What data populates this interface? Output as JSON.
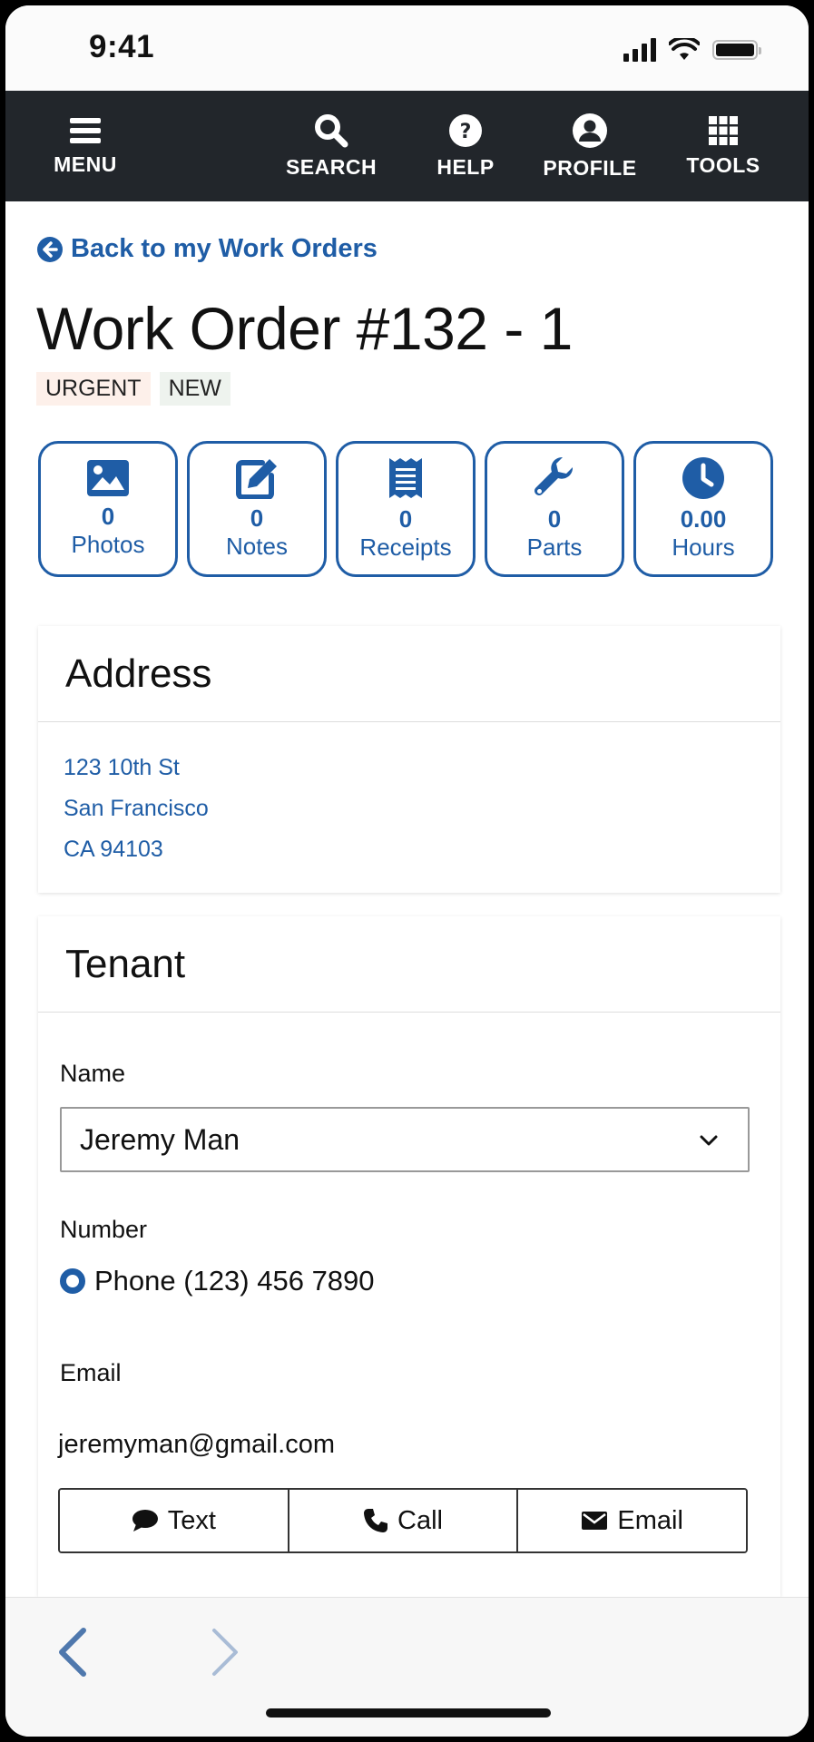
{
  "status_bar": {
    "time": "9:41"
  },
  "nav": {
    "menu": "MENU",
    "search": "SEARCH",
    "help": "HELP",
    "profile": "PROFILE",
    "tools": "TOOLS"
  },
  "back_link": "Back to my Work Orders",
  "title": "Work Order #132 - 1",
  "badges": {
    "urgent": "URGENT",
    "new": "NEW"
  },
  "tiles": [
    {
      "count": "0",
      "label": "Photos",
      "icon": "image-icon"
    },
    {
      "count": "0",
      "label": "Notes",
      "icon": "edit-icon"
    },
    {
      "count": "0",
      "label": "Receipts",
      "icon": "receipt-icon"
    },
    {
      "count": "0",
      "label": "Parts",
      "icon": "wrench-icon"
    },
    {
      "count": "0.00",
      "label": "Hours",
      "icon": "clock-icon"
    }
  ],
  "address": {
    "heading": "Address",
    "lines": [
      "123 10th St",
      "San Francisco",
      "CA 94103"
    ]
  },
  "tenant": {
    "heading": "Tenant",
    "name_label": "Name",
    "name_value": "Jeremy Man",
    "number_label": "Number",
    "phone": "Phone (123) 456 7890",
    "email_label": "Email",
    "email_value": "jeremyman@gmail.com",
    "actions": {
      "text": "Text",
      "call": "Call",
      "email": "Email"
    }
  },
  "colors": {
    "accent": "#1f5da6",
    "navbar": "#22262b",
    "urgent_bg": "#fdf0ea",
    "new_bg": "#eef3ee"
  }
}
